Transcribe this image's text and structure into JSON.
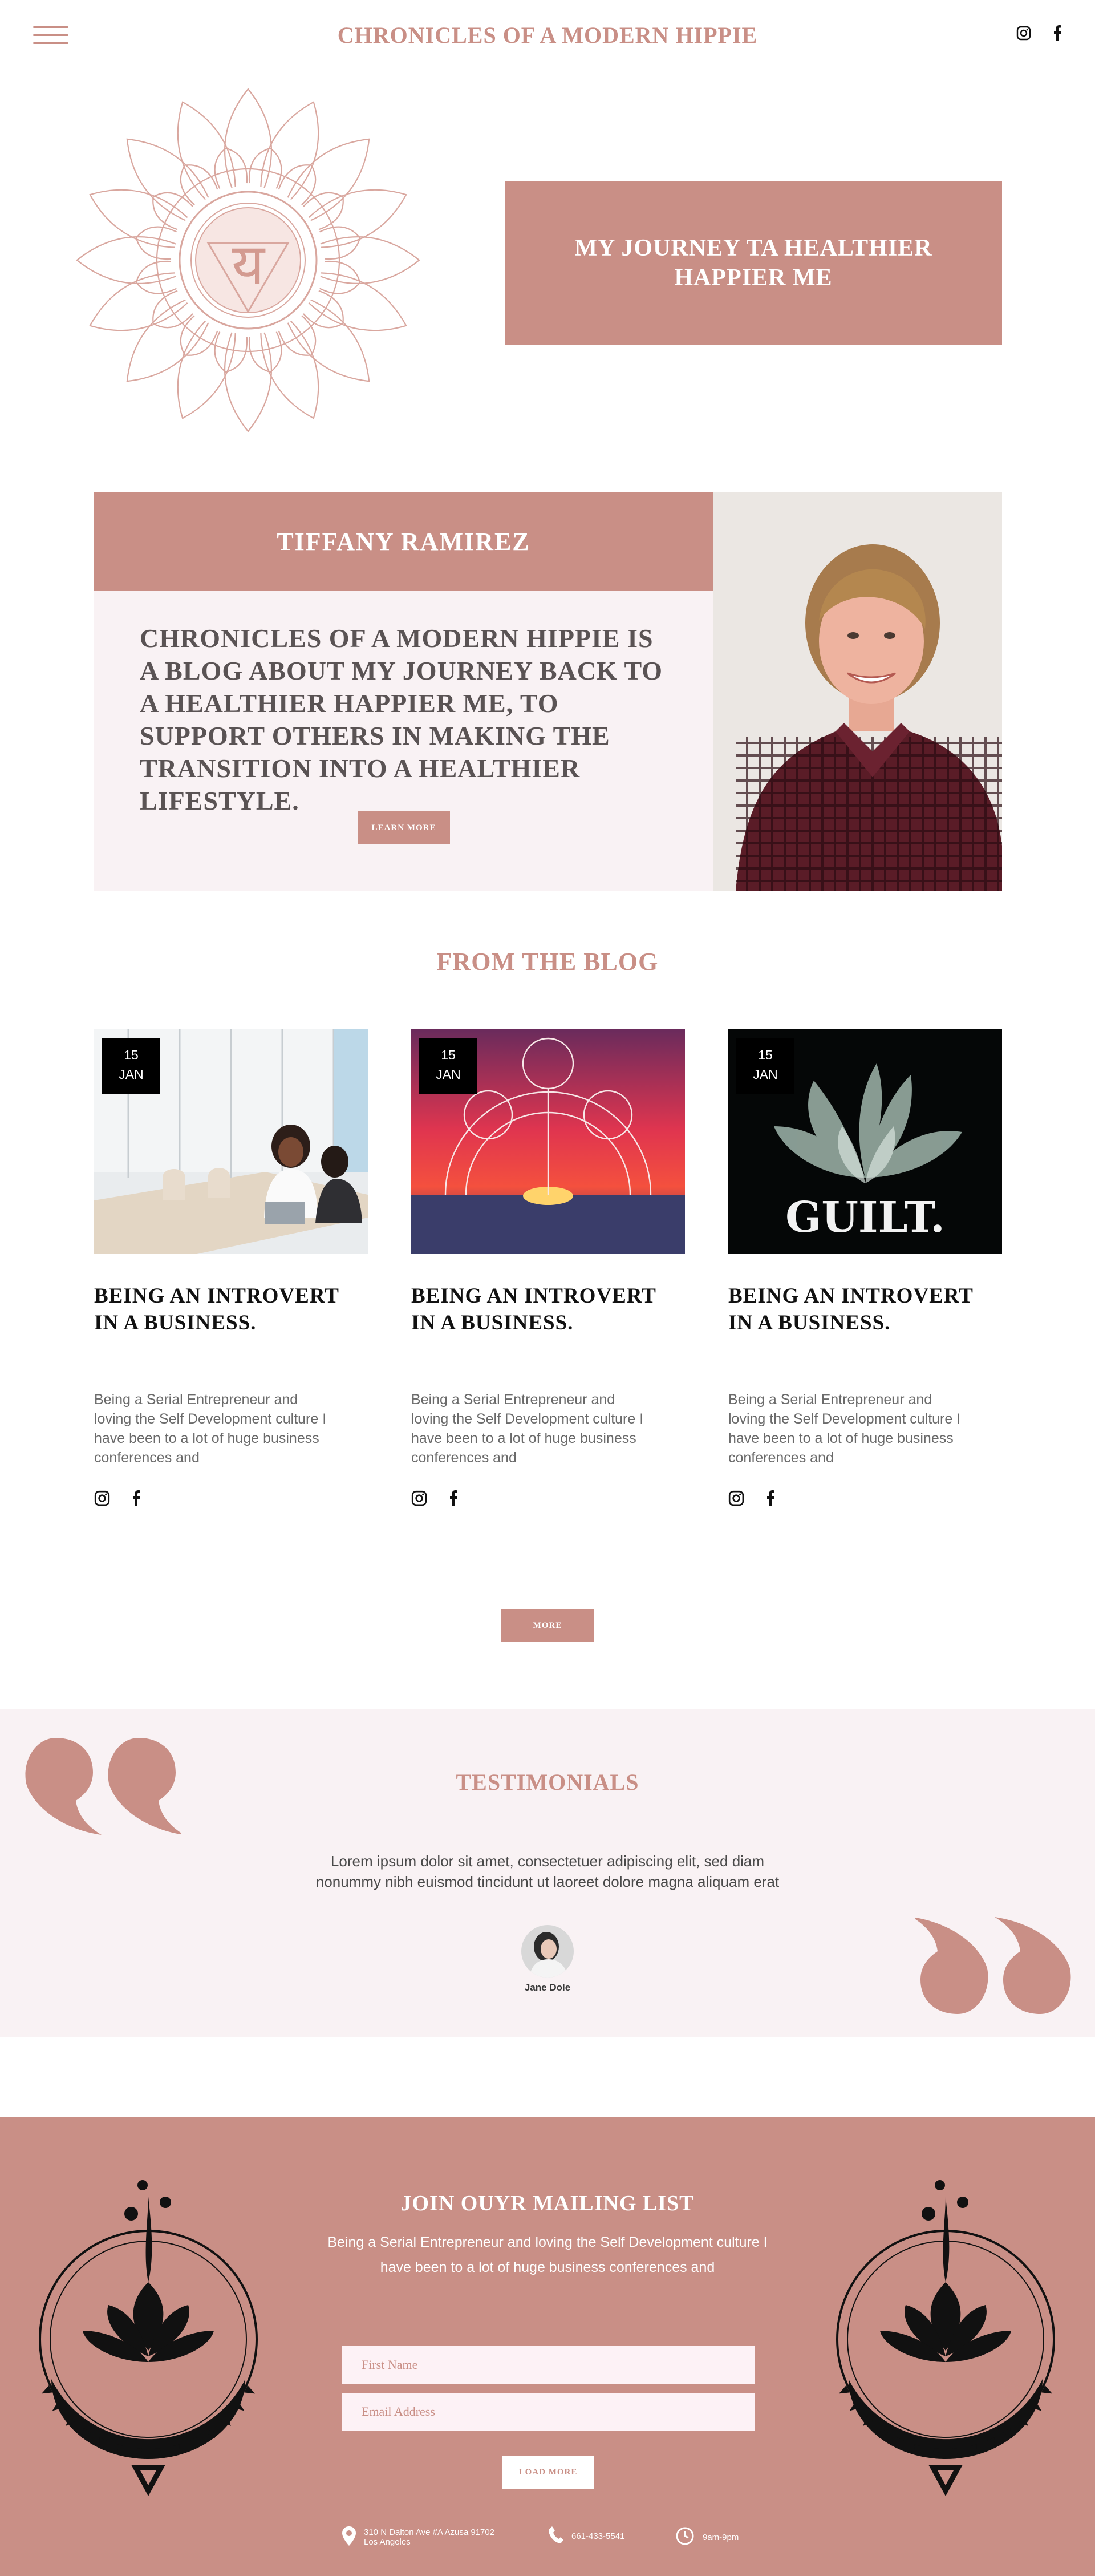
{
  "header": {
    "title": "CHRONICLES OF A MODERN HIPPIE",
    "menu_icon": "hamburger-menu-icon",
    "social": [
      "instagram-icon",
      "facebook-icon"
    ]
  },
  "hero": {
    "heading": "MY JOURNEY TA HEALTHIER HAPPIER ME",
    "mandala_glyph": "य"
  },
  "about": {
    "name": "TIFFANY RAMIREZ",
    "description": "CHRONICLES OF A MODERN HIPPIE IS A BLOG ABOUT MY JOURNEY BACK TO A HEALTHIER HAPPIER ME, TO SUPPORT OTHERS IN MAKING THE TRANSITION INTO A HEALTHIER LIFESTYLE.",
    "button": "LEARN MORE"
  },
  "blog": {
    "title": "FROM THE BLOG",
    "posts": [
      {
        "day": "15",
        "month": "JAN",
        "title": "BEING AN INTROVERT IN A BUSINESS.",
        "excerpt": "Being a Serial Entrepreneur and loving the Self Development culture I have been to a lot of huge business conferences and"
      },
      {
        "day": "15",
        "month": "JAN",
        "title": "BEING AN INTROVERT IN A BUSINESS.",
        "excerpt": "Being a Serial Entrepreneur and loving the Self Development culture I have been to a lot of huge business conferences and"
      },
      {
        "day": "15",
        "month": "JAN",
        "title": "BEING AN INTROVERT IN A BUSINESS.",
        "excerpt": "Being a Serial Entrepreneur and loving the Self Development culture I have been to a lot of huge business conferences and",
        "image_text": "GUILT."
      }
    ],
    "more_button": "MORE"
  },
  "testimonials": {
    "title": "TESTIMONIALS",
    "text": "Lorem ipsum dolor sit amet, consectetuer adipiscing elit, sed diam nonummy nibh euismod tincidunt ut laoreet dolore magna aliquam erat",
    "name": "Jane Dole"
  },
  "mailing": {
    "title": "JOIN OUYR MAILING LIST",
    "text": "Being a Serial Entrepreneur and loving the Self Development culture I have been to a lot of huge business conferences and",
    "first_name_placeholder": "First Name",
    "email_placeholder": "Email Address",
    "button": "LOAD MORE"
  },
  "contact": {
    "address_line1": "310 N Dalton Ave #A Azusa 91702",
    "address_line2": "Los Angeles",
    "phone": "661-433-5541",
    "hours": "9am-9pm"
  },
  "colors": {
    "accent": "#c98f86",
    "pale": "#f9f2f4",
    "dark": "#000000"
  }
}
